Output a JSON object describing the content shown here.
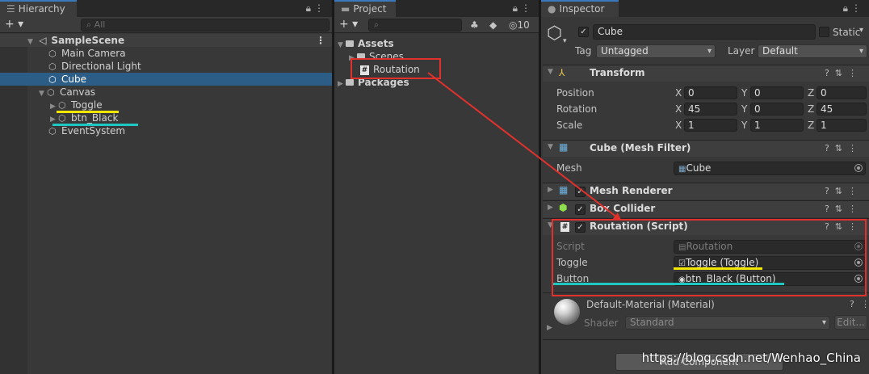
{
  "hierarchy": {
    "tab_label": "Hierarchy",
    "search_placeholder": "All",
    "scene_name": "SampleScene",
    "items": [
      {
        "label": "Main Camera"
      },
      {
        "label": "Directional Light"
      },
      {
        "label": "Cube"
      },
      {
        "label": "Canvas"
      },
      {
        "label": "Toggle"
      },
      {
        "label": "btn_Black"
      },
      {
        "label": "EventSystem"
      }
    ]
  },
  "project": {
    "tab_label": "Project",
    "hidden_count": "10",
    "tree": [
      {
        "label": "Assets"
      },
      {
        "label": "Scenes"
      },
      {
        "label": "Routation"
      },
      {
        "label": "Packages"
      }
    ]
  },
  "inspector": {
    "tab_label": "Inspector",
    "object_name": "Cube",
    "static_label": "Static",
    "tag_label": "Tag",
    "tag_value": "Untagged",
    "layer_label": "Layer",
    "layer_value": "Default",
    "transform": {
      "title": "Transform",
      "rows": [
        {
          "label": "Position",
          "x": "0",
          "y": "0",
          "z": "0"
        },
        {
          "label": "Rotation",
          "x": "45",
          "y": "0",
          "z": "45"
        },
        {
          "label": "Scale",
          "x": "1",
          "y": "1",
          "z": "1"
        }
      ],
      "axis_x": "X",
      "axis_y": "Y",
      "axis_z": "Z"
    },
    "mesh_filter": {
      "title": "Cube (Mesh Filter)",
      "mesh_label": "Mesh",
      "mesh_value": "Cube"
    },
    "mesh_renderer": {
      "title": "Mesh Renderer"
    },
    "box_collider": {
      "title": "Box Collider"
    },
    "script_comp": {
      "title": "Routation (Script)",
      "script_label": "Script",
      "script_value": "Routation",
      "toggle_label": "Toggle",
      "toggle_value": "Toggle (Toggle)",
      "button_label": "Button",
      "button_value": "btn_Black (Button)"
    },
    "material": {
      "title": "Default-Material (Material)",
      "shader_label": "Shader",
      "shader_value": "Standard",
      "edit_label": "Edit..."
    },
    "add_component_label": "Add Component"
  },
  "watermark": "https://blog.csdn.net/Wenhao_China",
  "colors": {
    "selection": "#2c5d87",
    "highlight_box": "#e0312d",
    "underline_yellow": "#f2e600",
    "underline_cyan": "#1fc7c2"
  }
}
